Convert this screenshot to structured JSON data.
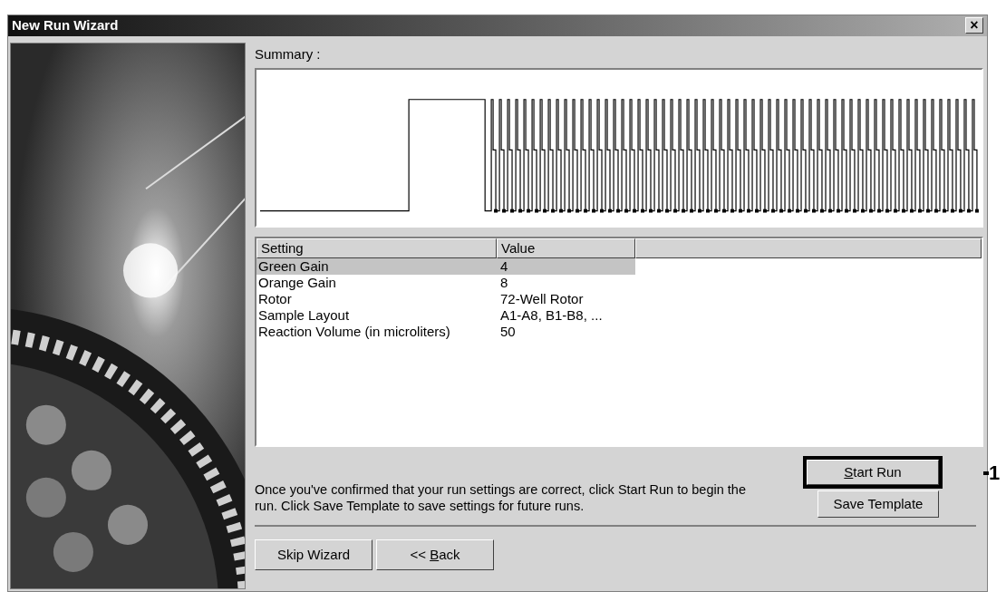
{
  "window": {
    "title": "New Run Wizard",
    "close": "×"
  },
  "summary_label": "Summary :",
  "table": {
    "columns": [
      "Setting",
      "Value"
    ],
    "rows": [
      {
        "setting": "Green Gain",
        "value": "4",
        "selected": true
      },
      {
        "setting": "Orange Gain",
        "value": "8",
        "selected": false
      },
      {
        "setting": "Rotor",
        "value": "72-Well Rotor",
        "selected": false
      },
      {
        "setting": "Sample Layout",
        "value": "A1-A8, B1-B8, ...",
        "selected": false
      },
      {
        "setting": "Reaction Volume (in microliters)",
        "value": "50",
        "selected": false
      }
    ]
  },
  "start_button": {
    "label_parts": [
      {
        "text": "S",
        "underlined": true
      },
      {
        "text": "tart Run",
        "underlined": false
      }
    ],
    "highlighted": true
  },
  "callout": "1",
  "save_button": {
    "label": "Save Template"
  },
  "instructions": "Once you've confirmed that your run settings are correct, click Start Run to begin the run. Click Save Template to save settings for future runs.",
  "footer_buttons": [
    {
      "label": "Skip Wizard"
    },
    {
      "label_parts": [
        {
          "text": "<< ",
          "underlined": false
        },
        {
          "text": "B",
          "underlined": true
        },
        {
          "text": "ack",
          "underlined": false
        }
      ]
    }
  ]
}
